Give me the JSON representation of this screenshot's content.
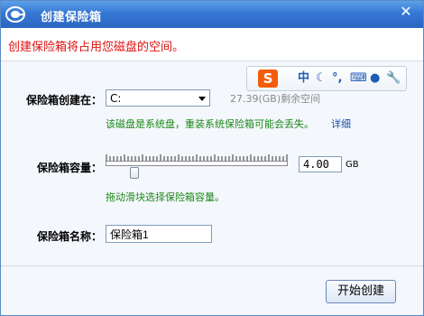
{
  "window": {
    "title": "创建保险箱",
    "close_glyph": "✕"
  },
  "header": {
    "message": "创建保险箱将占用您磁盘的空间。"
  },
  "ime_toolbar": {
    "logo": "S",
    "items": [
      "中",
      "☾",
      "°,",
      "⌨",
      "●",
      "🔧"
    ]
  },
  "location": {
    "label": "保险箱创建在：",
    "selected": "C:",
    "free_space": "27.39(GB)剩余空间",
    "warning": "该磁盘是系统盘，重装系统保险箱可能会丢失。",
    "details_link": "详细"
  },
  "capacity": {
    "label": "保险箱容量：",
    "value": "4.00",
    "unit": "GB",
    "hint": "拖动滑块选择保险箱容量。",
    "slider_fraction": 0.14
  },
  "name": {
    "label": "保险箱名称：",
    "value": "保险箱1"
  },
  "footer": {
    "start_label": "开始创建"
  },
  "colors": {
    "title_bar": "#3578d4",
    "warning_red": "#dd1111",
    "hint_green": "#1b8a1b",
    "link_blue": "#1c4fb0"
  }
}
